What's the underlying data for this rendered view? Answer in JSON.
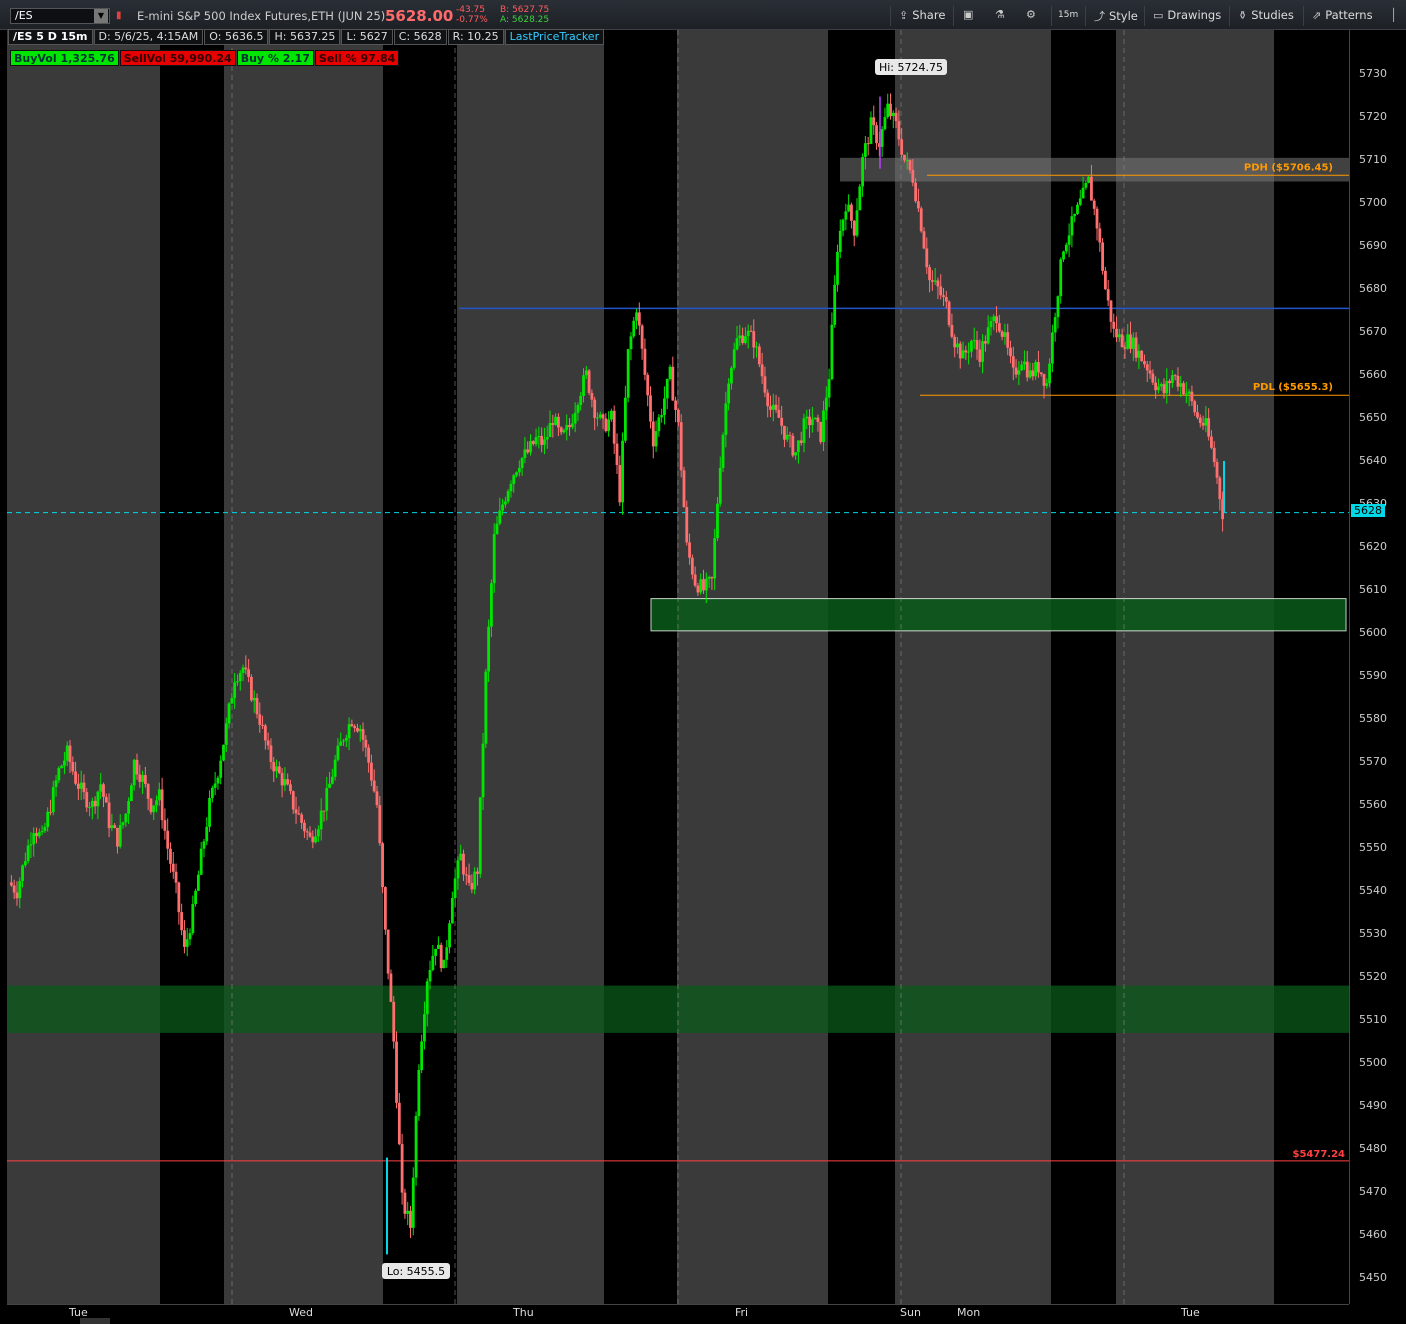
{
  "toolbar": {
    "symbol": "/ES",
    "symbol_dropdown_icon": "chevron-down-icon",
    "instrument_name": "E-mini S&P 500 Index Futures,ETH (JUN 25)",
    "last_price": "5628.00",
    "net_change": "-43.75",
    "pct_change": "-0.77%",
    "bid": "B: 5627.75",
    "ask": "A: 5628.25",
    "share_label": "Share",
    "interval_label": "15m",
    "style_label": "Style",
    "drawings_label": "Drawings",
    "studies_label": "Studies",
    "patterns_label": "Patterns"
  },
  "info_bar": {
    "chart_label": "/ES 5 D 15m",
    "date": "D: 5/6/25, 4:15AM",
    "open": "O: 5636.5",
    "high": "H: 5637.25",
    "low": "L: 5627",
    "close": "C: 5628",
    "range": "R: 10.25",
    "study": "LastPriceTracker"
  },
  "volume_bar": {
    "buy_vol": "BuyVol 1,325.76",
    "sell_vol": "SellVol 59,990.24",
    "buy_pct": "Buy % 2.17",
    "sell_pct": "Sell % 97.84"
  },
  "colors": {
    "up_candle": "#00e600",
    "down_candle": "#ff6f6f",
    "session_bg": "#3a3a3a",
    "overnight_bg": "#000000",
    "demand_zone": "#0a5a1a",
    "pdh_pdl": "#ff9900",
    "resistance_line": "#2357c9",
    "stop_line": "#ff4040",
    "price_tracker": "#00d8e8"
  },
  "annotations": {
    "high_label": "Hi: 5724.75",
    "low_label": "Lo: 5455.5",
    "pdh_label": "PDH ($5706.45)",
    "pdl_label": "PDL ($5655.3)",
    "stop_label": "$5477.24",
    "current_price_tag": "5628"
  },
  "chart_data": {
    "type": "candlestick",
    "ylim": [
      5445,
      5735
    ],
    "y_ticks": [
      5450,
      5460,
      5470,
      5480,
      5490,
      5500,
      5510,
      5520,
      5530,
      5540,
      5550,
      5560,
      5570,
      5580,
      5590,
      5600,
      5610,
      5620,
      5630,
      5640,
      5650,
      5660,
      5670,
      5680,
      5690,
      5700,
      5710,
      5720,
      5730
    ],
    "x_ticks": [
      "Tue",
      "Wed",
      "Thu",
      "Fri",
      "Sun",
      "Mon",
      "Tue"
    ],
    "levels": {
      "pdh": 5706.45,
      "pdl": 5655.3,
      "blue_line": 5675.5,
      "red_line": 5477.24,
      "last_price": 5628,
      "high": 5724.75,
      "low": 5455.5
    },
    "zones": [
      {
        "low": 5507,
        "high": 5518
      },
      {
        "low": 5600.5,
        "high": 5608
      },
      {
        "low": 5705,
        "high": 5710.5
      }
    ],
    "price_path": [
      [
        0,
        5542
      ],
      [
        1,
        5540
      ],
      [
        2,
        5548
      ],
      [
        3,
        5555
      ],
      [
        4,
        5552
      ],
      [
        5,
        5560
      ],
      [
        6,
        5568
      ],
      [
        7,
        5572
      ],
      [
        8,
        5566
      ],
      [
        9,
        5562
      ],
      [
        10,
        5560
      ],
      [
        11,
        5565
      ],
      [
        12,
        5556
      ],
      [
        13,
        5552
      ],
      [
        14,
        5558
      ],
      [
        15,
        5570
      ],
      [
        16,
        5566
      ],
      [
        17,
        5560
      ],
      [
        18,
        5562
      ],
      [
        19,
        5550
      ],
      [
        20,
        5540
      ],
      [
        21,
        5526
      ],
      [
        22,
        5535
      ],
      [
        23,
        5548
      ],
      [
        24,
        5560
      ],
      [
        25,
        5568
      ],
      [
        26,
        5578
      ],
      [
        27,
        5590
      ],
      [
        28,
        5592
      ],
      [
        29,
        5586
      ],
      [
        30,
        5580
      ],
      [
        31,
        5572
      ],
      [
        32,
        5568
      ],
      [
        33,
        5565
      ],
      [
        34,
        5560
      ],
      [
        35,
        5556
      ],
      [
        36,
        5552
      ],
      [
        37,
        5556
      ],
      [
        38,
        5562
      ],
      [
        39,
        5570
      ],
      [
        40,
        5576
      ],
      [
        41,
        5580
      ],
      [
        42,
        5578
      ],
      [
        43,
        5570
      ],
      [
        44,
        5560
      ],
      [
        45,
        5530
      ],
      [
        46,
        5505
      ],
      [
        47,
        5468
      ],
      [
        48,
        5462
      ],
      [
        49,
        5500
      ],
      [
        50,
        5520
      ],
      [
        51,
        5528
      ],
      [
        52,
        5522
      ],
      [
        53,
        5540
      ],
      [
        54,
        5548
      ],
      [
        55,
        5540
      ],
      [
        56,
        5545
      ],
      [
        57,
        5590
      ],
      [
        58,
        5622
      ],
      [
        59,
        5630
      ],
      [
        60,
        5636
      ],
      [
        61,
        5640
      ],
      [
        62,
        5642
      ],
      [
        63,
        5645
      ],
      [
        64,
        5644
      ],
      [
        65,
        5650
      ],
      [
        66,
        5645
      ],
      [
        67,
        5648
      ],
      [
        68,
        5655
      ],
      [
        69,
        5660
      ],
      [
        70,
        5652
      ],
      [
        71,
        5648
      ],
      [
        72,
        5650
      ],
      [
        73,
        5632
      ],
      [
        74,
        5665
      ],
      [
        75,
        5676
      ],
      [
        76,
        5660
      ],
      [
        77,
        5645
      ],
      [
        78,
        5652
      ],
      [
        79,
        5660
      ],
      [
        80,
        5648
      ],
      [
        81,
        5620
      ],
      [
        82,
        5612
      ],
      [
        83,
        5610
      ],
      [
        84,
        5612
      ],
      [
        85,
        5640
      ],
      [
        86,
        5660
      ],
      [
        87,
        5668
      ],
      [
        88,
        5670
      ],
      [
        89,
        5668
      ],
      [
        90,
        5660
      ],
      [
        91,
        5652
      ],
      [
        92,
        5650
      ],
      [
        93,
        5645
      ],
      [
        94,
        5642
      ],
      [
        95,
        5648
      ],
      [
        96,
        5650
      ],
      [
        97,
        5646
      ],
      [
        98,
        5660
      ],
      [
        99,
        5690
      ],
      [
        100,
        5700
      ],
      [
        101,
        5694
      ],
      [
        102,
        5710
      ],
      [
        103,
        5718
      ],
      [
        104,
        5714
      ],
      [
        105,
        5722
      ],
      [
        106,
        5718
      ],
      [
        107,
        5710
      ],
      [
        108,
        5706
      ],
      [
        109,
        5695
      ],
      [
        110,
        5682
      ],
      [
        111,
        5680
      ],
      [
        112,
        5676
      ],
      [
        113,
        5668
      ],
      [
        114,
        5664
      ],
      [
        115,
        5668
      ],
      [
        116,
        5665
      ],
      [
        117,
        5670
      ],
      [
        118,
        5674
      ],
      [
        119,
        5668
      ],
      [
        120,
        5660
      ],
      [
        121,
        5664
      ],
      [
        122,
        5660
      ],
      [
        123,
        5662
      ],
      [
        124,
        5658
      ],
      [
        125,
        5675
      ],
      [
        126,
        5690
      ],
      [
        127,
        5695
      ],
      [
        128,
        5700
      ],
      [
        129,
        5705
      ],
      [
        130,
        5695
      ],
      [
        131,
        5680
      ],
      [
        132,
        5670
      ],
      [
        133,
        5668
      ],
      [
        134,
        5668
      ],
      [
        135,
        5665
      ],
      [
        136,
        5662
      ],
      [
        137,
        5658
      ],
      [
        138,
        5656
      ],
      [
        139,
        5660
      ],
      [
        140,
        5658
      ],
      [
        141,
        5655
      ],
      [
        142,
        5650
      ],
      [
        143,
        5648
      ],
      [
        144,
        5640
      ],
      [
        145,
        5628
      ]
    ]
  }
}
